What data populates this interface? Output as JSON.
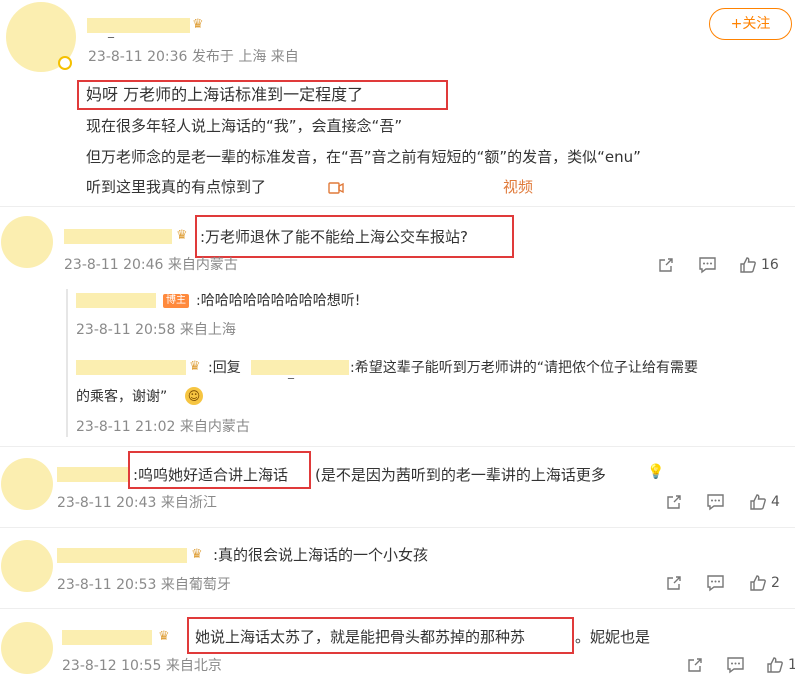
{
  "post": {
    "author_suffix": "_",
    "meta": "23-8-11 20:36 发布于 上海 来自",
    "follow_label": "+关注",
    "lines": [
      "妈呀 万老师的上海话标准到一定程度了",
      "现在很多年轻人说上海话的“我”，会直接念“吾”",
      "但万老师念的是老一辈的标准发音，在“吾”音之前有短短的“额”的发音，类似“enu”",
      "听到这里我真的有点惊到了"
    ],
    "video_label": "视频"
  },
  "comments": [
    {
      "text": ":万老师退休了能不能给上海公交车报站?",
      "meta": "23-8-11 20:46 来自内蒙古",
      "like_count": "16"
    },
    {
      "badge": "博主",
      "text": ":哈哈哈哈哈哈哈哈哈想听!",
      "meta": "23-8-11 20:58 来自上海"
    },
    {
      "reply_prefix": ":回复",
      "reply_suffix": "_",
      "text_line1": ":希望这辈子能听到万老师讲的“请把侬个位子让给有需要",
      "text_line2": "的乘客，谢谢”",
      "meta": "23-8-11 21:02 来自内蒙古"
    },
    {
      "text": ":呜呜她好适合讲上海话",
      "text_extra": "(是不是因为茜听到的老一辈讲的上海话更多",
      "meta": "23-8-11 20:43 来自浙江",
      "like_count": "4"
    },
    {
      "text": ":真的很会说上海话的一个小女孩",
      "meta": "23-8-11 20:53 来自葡萄牙",
      "like_count": "2"
    },
    {
      "text": "她说上海话太苏了，就是能把骨头都苏掉的那种苏",
      "text_extra": "。妮妮也是",
      "meta": "23-8-12 10:55 来自北京",
      "like_count": "1"
    }
  ],
  "colors": {
    "accent": "#ff8200",
    "highlight_box": "#e03a3a",
    "avatar_placeholder": "#fbeeb0"
  },
  "icons": [
    "crown-icon",
    "video-icon",
    "share-icon",
    "comment-icon",
    "like-icon",
    "smile-emoji-icon",
    "bulb-emoji-icon"
  ]
}
